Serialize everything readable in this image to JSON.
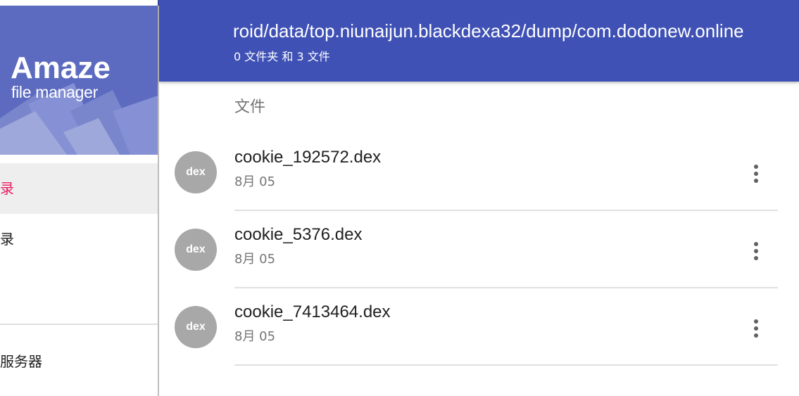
{
  "drawer": {
    "logo": {
      "title": "Amaze",
      "subtitle": "file manager"
    },
    "items": [
      {
        "label": "录",
        "active": true
      },
      {
        "label": "录",
        "active": false
      },
      {
        "label": "服务器",
        "active": false
      }
    ]
  },
  "appbar": {
    "path": "roid/data/top.niunaijun.blackdexa32/dump/com.dodonew.online",
    "summary": "0 文件夹 和 3 文件"
  },
  "content": {
    "section_label": "文件",
    "files": [
      {
        "icon_text": "dex",
        "name": "cookie_192572.dex",
        "date": "8月 05"
      },
      {
        "icon_text": "dex",
        "name": "cookie_5376.dex",
        "date": "8月 05"
      },
      {
        "icon_text": "dex",
        "name": "cookie_7413464.dex",
        "date": "8月 05"
      }
    ]
  },
  "colors": {
    "appbar": "#3f51b5",
    "drawer_header": "#5c6bc0",
    "active_text": "#e91e63",
    "file_icon": "#a8a8a8"
  },
  "icons": {
    "row_menu": "more-vert-icon",
    "file_type": "dex-file-icon"
  }
}
